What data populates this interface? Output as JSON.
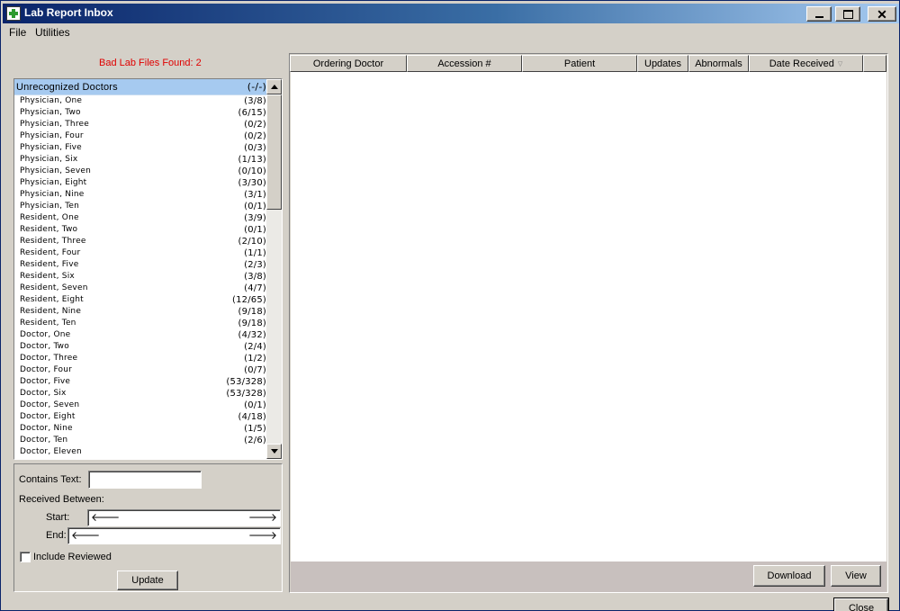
{
  "window": {
    "title": "Lab Report Inbox"
  },
  "menu": {
    "items": [
      {
        "label": "File"
      },
      {
        "label": "Utilities"
      }
    ]
  },
  "bad_files": "Bad Lab Files Found: 2",
  "doctor_list": {
    "header": {
      "name": "Unrecognized Doctors",
      "count": "(-/-)"
    },
    "items": [
      {
        "name": "Physician, One",
        "count": "(3/8)"
      },
      {
        "name": "Physician, Two",
        "count": "(6/15)"
      },
      {
        "name": "Physician, Three",
        "count": "(0/2)"
      },
      {
        "name": "Physician, Four",
        "count": "(0/2)"
      },
      {
        "name": "Physician, Five",
        "count": "(0/3)"
      },
      {
        "name": "Physician, Six",
        "count": "(1/13)"
      },
      {
        "name": "Physician, Seven",
        "count": "(0/10)"
      },
      {
        "name": "Physician, Eight",
        "count": "(3/30)"
      },
      {
        "name": "Physician, Nine",
        "count": "(3/1)"
      },
      {
        "name": "Physician, Ten",
        "count": "(0/1)"
      },
      {
        "name": "Resident, One",
        "count": "(3/9)"
      },
      {
        "name": "Resident, Two",
        "count": "(0/1)"
      },
      {
        "name": "Resident, Three",
        "count": "(2/10)"
      },
      {
        "name": "Resident, Four",
        "count": "(1/1)"
      },
      {
        "name": "Resident, Five",
        "count": "(2/3)"
      },
      {
        "name": "Resident, Six",
        "count": "(3/8)"
      },
      {
        "name": "Resident, Seven",
        "count": "(4/7)"
      },
      {
        "name": "Resident, Eight",
        "count": "(12/65)"
      },
      {
        "name": "Resident, Nine",
        "count": "(9/18)"
      },
      {
        "name": "Resident, Ten",
        "count": "(9/18)"
      },
      {
        "name": "Doctor, One",
        "count": "(4/32)"
      },
      {
        "name": "Doctor, Two",
        "count": "(2/4)"
      },
      {
        "name": "Doctor, Three",
        "count": "(1/2)"
      },
      {
        "name": "Doctor, Four",
        "count": "(0/7)"
      },
      {
        "name": "Doctor, Five",
        "count": "(53/328)"
      },
      {
        "name": "Doctor, Six",
        "count": "(53/328)"
      },
      {
        "name": "Doctor, Seven",
        "count": "(0/1)"
      },
      {
        "name": "Doctor, Eight",
        "count": "(4/18)"
      },
      {
        "name": "Doctor, Nine",
        "count": "(1/5)"
      },
      {
        "name": "Doctor, Ten",
        "count": "(2/6)"
      },
      {
        "name": "Doctor, Eleven",
        "count": ""
      }
    ]
  },
  "filters": {
    "contains_text_label": "Contains Text:",
    "contains_text_value": "",
    "received_between_label": "Received Between:",
    "start_label": "Start:",
    "end_label": "End:",
    "include_reviewed_label": "Include Reviewed",
    "include_reviewed_checked": false,
    "update_button": "Update"
  },
  "grid": {
    "columns": [
      {
        "label": "Ordering Doctor"
      },
      {
        "label": "Accession #"
      },
      {
        "label": "Patient"
      },
      {
        "label": "Updates"
      },
      {
        "label": "Abnormals"
      },
      {
        "label": "Date Received",
        "sort_icon": "sort-desc-icon"
      }
    ]
  },
  "buttons": {
    "download": "Download",
    "view": "View",
    "close": "Close"
  },
  "colors": {
    "title_bar_start": "#0a246a",
    "selection": "#a6caf0",
    "warning_text": "#e00000",
    "window_bg": "#d4d0c8"
  }
}
